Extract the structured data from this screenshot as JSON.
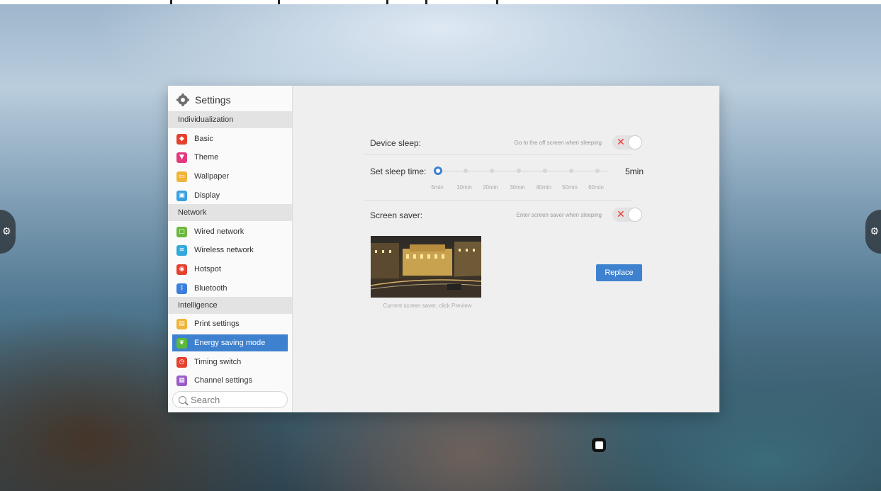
{
  "sidebar": {
    "title": "Settings",
    "sections": [
      {
        "label": "Individualization"
      },
      {
        "label": "Network"
      },
      {
        "label": "Intelligence"
      }
    ],
    "items": [
      {
        "label": "Basic",
        "icon": "layers-icon",
        "color": "#e5412f"
      },
      {
        "label": "Theme",
        "icon": "shirt-icon",
        "color": "#e2397f"
      },
      {
        "label": "Wallpaper",
        "icon": "picture-icon",
        "color": "#f0b43a"
      },
      {
        "label": "Display",
        "icon": "monitor-icon",
        "color": "#3aa0e0"
      },
      {
        "label": "Wired network",
        "icon": "wired-network-icon",
        "color": "#6cb83c"
      },
      {
        "label": "Wireless network",
        "icon": "wifi-icon",
        "color": "#33a9d9"
      },
      {
        "label": "Hotspot",
        "icon": "hotspot-icon",
        "color": "#e5412f"
      },
      {
        "label": "Bluetooth",
        "icon": "bluetooth-icon",
        "color": "#3a7fdc"
      },
      {
        "label": "Print settings",
        "icon": "printer-icon",
        "color": "#f0b43a"
      },
      {
        "label": "Energy saving mode",
        "icon": "leaf-icon",
        "color": "#5cb83c"
      },
      {
        "label": "Timing switch",
        "icon": "clock-icon",
        "color": "#e5412f"
      },
      {
        "label": "Channel settings",
        "icon": "channel-icon",
        "color": "#9a5cc8"
      }
    ],
    "active_index": 9,
    "search_placeholder": "Search"
  },
  "content": {
    "device_sleep": {
      "label": "Device sleep:",
      "hint": "Go to the off screen when sleeping",
      "enabled": false
    },
    "sleep_time": {
      "label": "Set sleep time:",
      "value": "5min",
      "options": [
        "5min",
        "10min",
        "20min",
        "30min",
        "40min",
        "50min",
        "60min"
      ],
      "selected_index": 0
    },
    "screen_saver": {
      "label": "Screen saver:",
      "hint": "Enter screen saver when sleeping",
      "enabled": false
    },
    "preview_caption": "Current screen saver, click Preview",
    "replace_label": "Replace"
  },
  "colors": {
    "accent": "#3e82cf",
    "toggle_off_x": "#e33333"
  }
}
